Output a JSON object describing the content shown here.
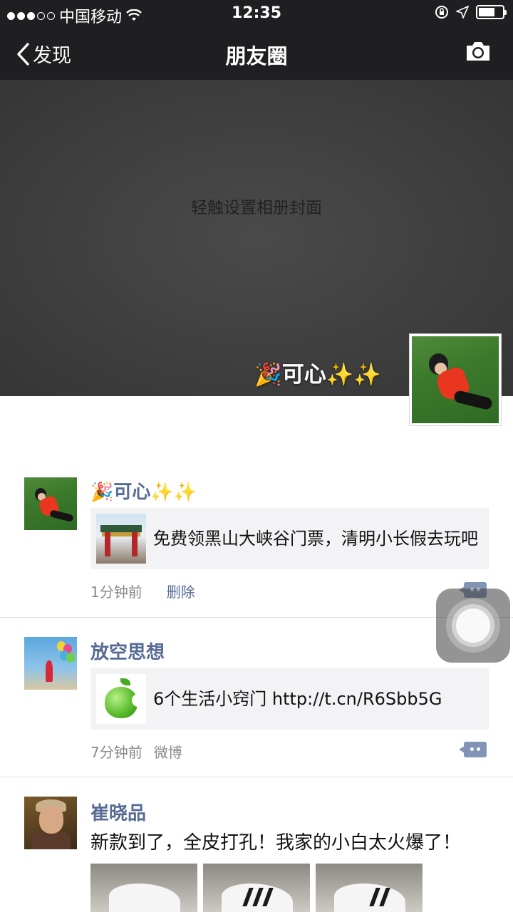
{
  "status_bar": {
    "carrier": "中国移动",
    "time": "12:35"
  },
  "nav": {
    "back_label": "发现",
    "title": "朋友圈"
  },
  "cover": {
    "hint": "轻触设置相册封面",
    "profile_name": "🎉可心✨✨"
  },
  "posts": [
    {
      "name": "🎉可心✨✨",
      "link_text": "免费领黑山大峡谷门票，清明小长假去玩吧",
      "time": "1分钟前",
      "action": "删除"
    },
    {
      "name": "放空思想",
      "link_text": "6个生活小窍门 http://t.cn/R6Sbb5G",
      "time": "7分钟前",
      "source": "微博"
    },
    {
      "name": "崔晓品",
      "text": "新款到了，全皮打孔！我家的小白太火爆了！"
    }
  ],
  "colors": {
    "nav_background": "#1f1f21",
    "name_link": "#576b95",
    "card_background": "#f3f3f5"
  }
}
